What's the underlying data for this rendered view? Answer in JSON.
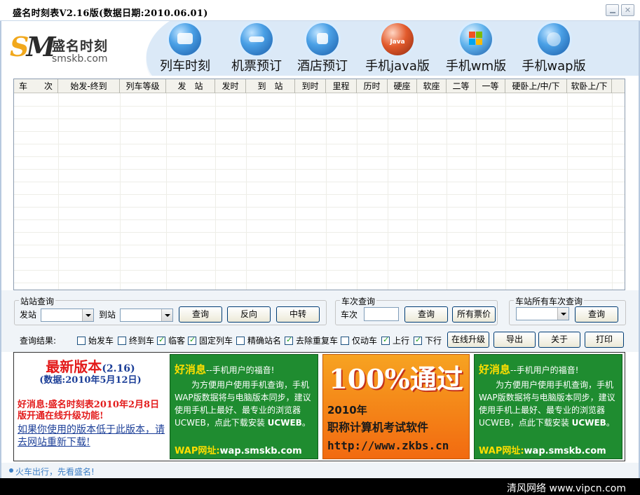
{
  "window": {
    "title": "盛名时刻表V2.16版(数据日期:2010.06.01)",
    "min_label": "",
    "close_label": "✕"
  },
  "logo": {
    "mark": "SM",
    "name": "盛名时刻",
    "url": "smskb.com"
  },
  "nav": [
    {
      "label": "列车时刻",
      "icon": "train-icon"
    },
    {
      "label": "机票预订",
      "icon": "airplane-icon"
    },
    {
      "label": "酒店预订",
      "icon": "hotel-icon"
    },
    {
      "label": "手机java版",
      "icon": "java-icon",
      "badge": "Java"
    },
    {
      "label": "手机wm版",
      "icon": "windows-icon"
    },
    {
      "label": "手机wap版",
      "icon": "globe-icon"
    }
  ],
  "table": {
    "columns": [
      "车　　次",
      "始发-终到",
      "列车等级",
      "发　站",
      "发时",
      "到　站",
      "到时",
      "里程",
      "历时",
      "硬座",
      "软座",
      "二等",
      "一等",
      "硬卧上/中/下",
      "软卧上/下"
    ],
    "rows": []
  },
  "station_query": {
    "legend": "站站查询",
    "from_label": "发站",
    "to_label": "到站",
    "from_value": "",
    "to_value": "",
    "query_button": "查询",
    "reverse_button": "反向",
    "transfer_button": "中转"
  },
  "train_query": {
    "legend": "车次查询",
    "train_label": "车次",
    "train_value": "",
    "query_button": "查询",
    "all_fares_button": "所有票价"
  },
  "station_all_query": {
    "legend": "车站所有车次查询",
    "station_value": "",
    "query_button": "查询"
  },
  "filters": {
    "label": "查询结果:",
    "items": [
      {
        "label": "始发车",
        "checked": false
      },
      {
        "label": "终到车",
        "checked": false
      },
      {
        "label": "临客",
        "checked": true
      },
      {
        "label": "固定列车",
        "checked": true
      },
      {
        "label": "精确站名",
        "checked": false
      },
      {
        "label": "去除重复车",
        "checked": true
      },
      {
        "label": "仅动车",
        "checked": false
      },
      {
        "label": "上行",
        "checked": true
      },
      {
        "label": "下行",
        "checked": true
      }
    ],
    "buttons": [
      "在线升级",
      "导出",
      "关于",
      "打印"
    ]
  },
  "promo": {
    "latest_title": "最新版本",
    "latest_version": "(2.16)",
    "data_date": "(数据:2010年5月12日)",
    "news": "好消息:盛名时刻表2010年2月8日版开通在线升级功能!",
    "link": "如果你使用的版本低于此版本，请去网站重新下载!",
    "green_head": "好消息",
    "green_sub": "--手机用户的福音!",
    "green_body": "为方便用户使用手机查询，手机WAP版数据将与电脑版本同步，建议使用手机上最好、最专业的浏览器UCWEB，点此下载安装",
    "green_bold": "UCWEB",
    "green_end": "。",
    "wap_label": "WAP网址:",
    "wap_url": "wap.smskb.com",
    "ad_big": "100%通过",
    "ad_year": "2010年",
    "ad_sub": "职称计算机考试软件",
    "ad_url": "http://www.zkbs.cn"
  },
  "status": {
    "text": "火车出行，先看盛名!"
  },
  "watermark": "清风网络 www.vipcn.com",
  "colors": {
    "accent_red": "#e31b1b",
    "accent_blue": "#1c3f98",
    "promo_green": "#1f8c30",
    "promo_orange": "#f26a10"
  }
}
